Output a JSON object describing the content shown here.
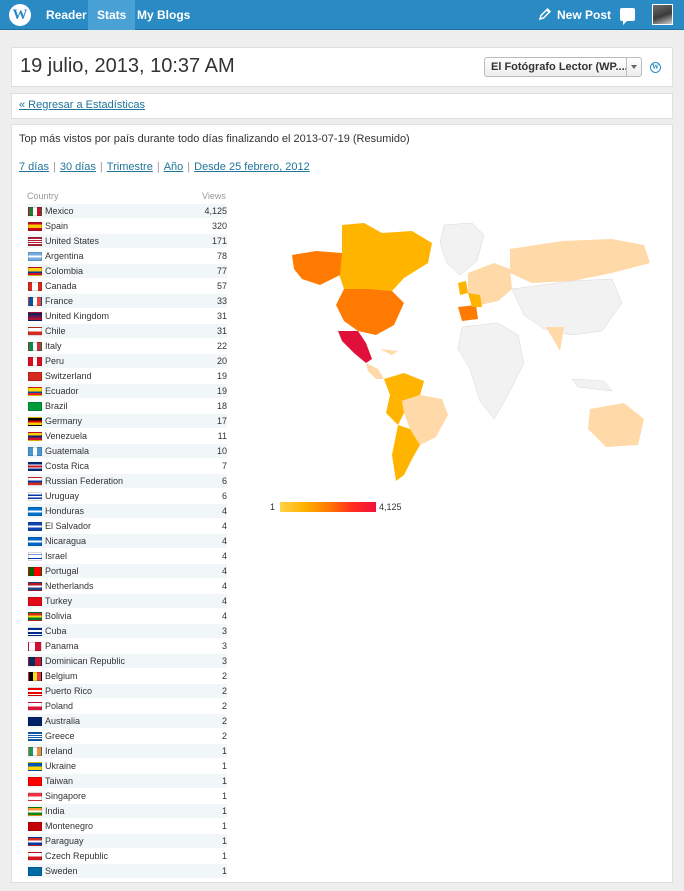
{
  "topbar": {
    "logo_glyph": "W",
    "nav": [
      "Reader",
      "Stats",
      "My Blogs"
    ],
    "new_post": "New Post",
    "icons": [
      "wordpress-logo-icon",
      "pencil-icon",
      "comment-bubble-icon",
      "avatar"
    ]
  },
  "header": {
    "date": "19 julio, 2013, 10:37 AM",
    "blog_select": "El Fotógrafo Lector (WP....",
    "wp_icon": "W"
  },
  "back_link": "« Regresar a Estadísticas",
  "main": {
    "heading": "Top más vistos por país durante todo días finalizando el 2013-07-19 (Resumido)",
    "periods": [
      "7 días",
      "30 días",
      "Trimestre",
      "Año",
      "Desde 25 febrero, 2012"
    ],
    "separator": "|",
    "columns": {
      "country": "Country",
      "views": "Views"
    }
  },
  "countries": [
    {
      "name": "Mexico",
      "views": "4,125"
    },
    {
      "name": "Spain",
      "views": "320"
    },
    {
      "name": "United States",
      "views": "171"
    },
    {
      "name": "Argentina",
      "views": "78"
    },
    {
      "name": "Colombia",
      "views": "77"
    },
    {
      "name": "Canada",
      "views": "57"
    },
    {
      "name": "France",
      "views": "33"
    },
    {
      "name": "United Kingdom",
      "views": "31"
    },
    {
      "name": "Chile",
      "views": "31"
    },
    {
      "name": "Italy",
      "views": "22"
    },
    {
      "name": "Peru",
      "views": "20"
    },
    {
      "name": "Switzerland",
      "views": "19"
    },
    {
      "name": "Ecuador",
      "views": "19"
    },
    {
      "name": "Brazil",
      "views": "18"
    },
    {
      "name": "Germany",
      "views": "17"
    },
    {
      "name": "Venezuela",
      "views": "11"
    },
    {
      "name": "Guatemala",
      "views": "10"
    },
    {
      "name": "Costa Rica",
      "views": "7"
    },
    {
      "name": "Russian Federation",
      "views": "6"
    },
    {
      "name": "Uruguay",
      "views": "6"
    },
    {
      "name": "Honduras",
      "views": "4"
    },
    {
      "name": "El Salvador",
      "views": "4"
    },
    {
      "name": "Nicaragua",
      "views": "4"
    },
    {
      "name": "Israel",
      "views": "4"
    },
    {
      "name": "Portugal",
      "views": "4"
    },
    {
      "name": "Netherlands",
      "views": "4"
    },
    {
      "name": "Turkey",
      "views": "4"
    },
    {
      "name": "Bolivia",
      "views": "4"
    },
    {
      "name": "Cuba",
      "views": "3"
    },
    {
      "name": "Panama",
      "views": "3"
    },
    {
      "name": "Dominican Republic",
      "views": "3"
    },
    {
      "name": "Belgium",
      "views": "2"
    },
    {
      "name": "Puerto Rico",
      "views": "2"
    },
    {
      "name": "Poland",
      "views": "2"
    },
    {
      "name": "Australia",
      "views": "2"
    },
    {
      "name": "Greece",
      "views": "2"
    },
    {
      "name": "Ireland",
      "views": "1"
    },
    {
      "name": "Ukraine",
      "views": "1"
    },
    {
      "name": "Taiwan",
      "views": "1"
    },
    {
      "name": "Singapore",
      "views": "1"
    },
    {
      "name": "India",
      "views": "1"
    },
    {
      "name": "Montenegro",
      "views": "1"
    },
    {
      "name": "Paraguay",
      "views": "1"
    },
    {
      "name": "Czech Republic",
      "views": "1"
    },
    {
      "name": "Sweden",
      "views": "1"
    }
  ],
  "legend": {
    "min": "1",
    "max": "4,125"
  },
  "colors": {
    "topbar": "#2a8bc4",
    "link": "#21759b",
    "map_none": "#f2f2f2",
    "map_low": "#ffd9a8",
    "map_mid": "#ffb400",
    "map_high": "#ff7a00",
    "map_top": "#e0103a"
  }
}
